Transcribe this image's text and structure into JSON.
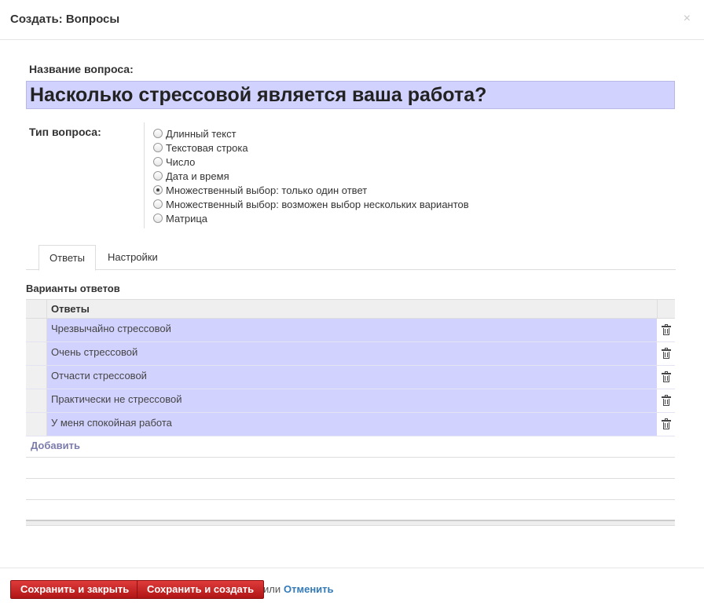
{
  "dialog": {
    "title": "Создать: Вопросы",
    "close_glyph": "×"
  },
  "question": {
    "name_label": "Название вопроса:",
    "name_value": "Насколько стрессовой является ваша работа?",
    "type_label": "Тип вопроса:",
    "type_options": [
      {
        "label": "Длинный текст",
        "checked": false
      },
      {
        "label": "Текстовая строка",
        "checked": false
      },
      {
        "label": "Число",
        "checked": false
      },
      {
        "label": "Дата и время",
        "checked": false
      },
      {
        "label": "Множественный выбор: только один ответ",
        "checked": true
      },
      {
        "label": "Множественный выбор: возможен выбор нескольких вариантов",
        "checked": false
      },
      {
        "label": "Матрица",
        "checked": false
      }
    ]
  },
  "tabs": [
    {
      "label": "Ответы",
      "active": true
    },
    {
      "label": "Настройки",
      "active": false
    }
  ],
  "answers": {
    "section_title": "Варианты ответов",
    "column_header": "Ответы",
    "rows": [
      "Чрезвычайно стрессовой",
      "Очень стрессовой",
      "Отчасти стрессовой",
      "Практически не стрессовой",
      "У меня спокойная работа"
    ],
    "add_label": "Добавить"
  },
  "footer": {
    "save_close_label": "Сохранить и закрыть",
    "save_new_label": "Сохранить и создать",
    "or_text": "или",
    "cancel_label": "Отменить"
  },
  "colors": {
    "input_bg": "#d2d2ff",
    "button_red": "#c42020",
    "link_blue": "#337ab7",
    "add_link": "#7c7bad"
  }
}
